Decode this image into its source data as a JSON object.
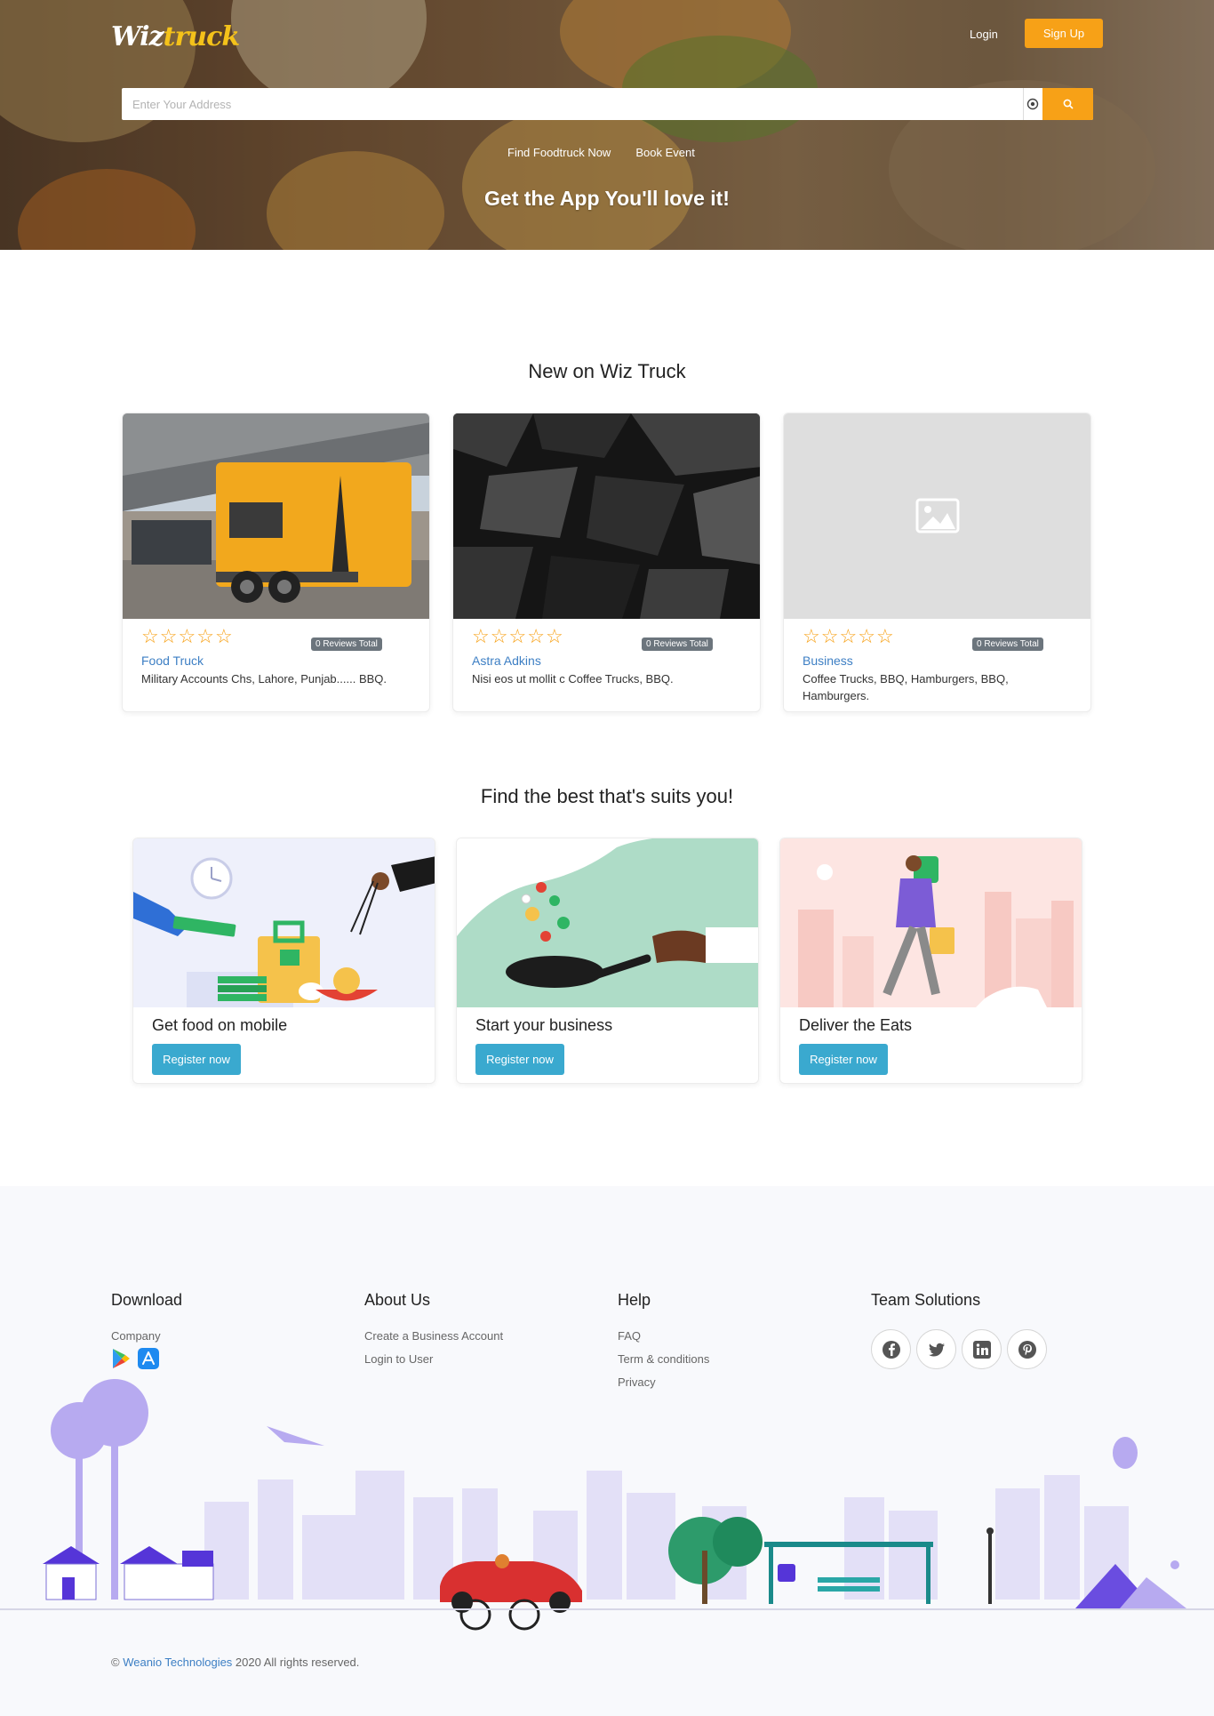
{
  "header": {
    "logo_part1": "Wiz",
    "logo_part2": "truck",
    "login": "Login",
    "signup": "Sign Up",
    "search_placeholder": "Enter Your Address",
    "nav": [
      "Find Foodtruck Now",
      "Book Event"
    ],
    "tagline": "Get the App You'll love it!"
  },
  "new_section": {
    "title": "New on Wiz Truck",
    "cards": [
      {
        "name": "Food Truck",
        "desc": "Military Accounts Chs, Lahore, Punjab...... BBQ.",
        "reviews": "0 Reviews Total",
        "rating": 0
      },
      {
        "name": "Astra Adkins",
        "desc": "Nisi eos ut mollit c Coffee Trucks, BBQ.",
        "reviews": "0 Reviews Total",
        "rating": 0
      },
      {
        "name": "Business",
        "desc": "Coffee Trucks, BBQ, Hamburgers, BBQ, Hamburgers.",
        "reviews": "0 Reviews Total",
        "rating": 0
      }
    ]
  },
  "features_section": {
    "title": "Find the best that's suits you!",
    "items": [
      {
        "title": "Get food on mobile",
        "button": "Register now"
      },
      {
        "title": "Start your business",
        "button": "Register now"
      },
      {
        "title": "Deliver the Eats",
        "button": "Register now"
      }
    ]
  },
  "footer": {
    "download": {
      "heading": "Download",
      "company": "Company"
    },
    "about": {
      "heading": "About Us",
      "links": [
        "Create a Business Account",
        "Login to User"
      ]
    },
    "help": {
      "heading": "Help",
      "links": [
        "FAQ",
        "Term & conditions",
        "Privacy"
      ]
    },
    "team": {
      "heading": "Team Solutions"
    },
    "copyright_brand": "Weanio Technologies",
    "copyright_rest": " 2020 All rights reserved."
  },
  "colors": {
    "accent": "#f7a117",
    "link": "#3d7fc4",
    "button_blue": "#3aa9cf"
  }
}
